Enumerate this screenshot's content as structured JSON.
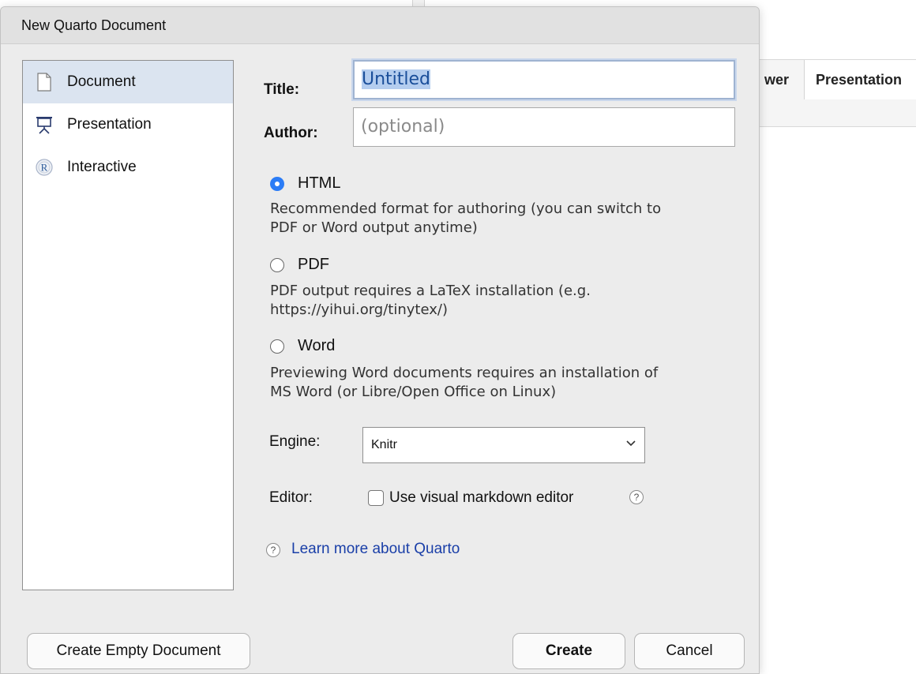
{
  "background": {
    "tabs": [
      {
        "label": "wer"
      },
      {
        "label": "Presentation"
      }
    ]
  },
  "dialog": {
    "title": "New Quarto Document",
    "types": [
      {
        "label": "Document",
        "icon": "document-icon",
        "selected": true
      },
      {
        "label": "Presentation",
        "icon": "presentation-icon",
        "selected": false
      },
      {
        "label": "Interactive",
        "icon": "r-logo-icon",
        "selected": false
      }
    ],
    "form": {
      "title_label": "Title:",
      "title_value": "Untitled",
      "author_label": "Author:",
      "author_placeholder": "(optional)",
      "formats": [
        {
          "label": "HTML",
          "checked": true,
          "desc_line1": "Recommended format for authoring (you can switch to",
          "desc_line2": "PDF or Word output anytime)"
        },
        {
          "label": "PDF",
          "checked": false,
          "desc_line1": "PDF output requires a LaTeX installation (e.g.",
          "desc_line2": "https://yihui.org/tinytex/)"
        },
        {
          "label": "Word",
          "checked": false,
          "desc_line1": "Previewing Word documents requires an installation of",
          "desc_line2": "MS Word (or Libre/Open Office on Linux)"
        }
      ],
      "engine_label": "Engine:",
      "engine_value": "Knitr",
      "editor_label": "Editor:",
      "visual_editor_label": "Use visual markdown editor",
      "visual_editor_checked": false,
      "help_glyph": "?",
      "learn_more_link": "Learn more about Quarto"
    },
    "buttons": {
      "create_empty": "Create Empty Document",
      "create": "Create",
      "cancel": "Cancel"
    }
  },
  "colors": {
    "accent_radio": "#2b7cf6",
    "selection_bg": "#dbe4f0",
    "link": "#1a3fa8"
  }
}
